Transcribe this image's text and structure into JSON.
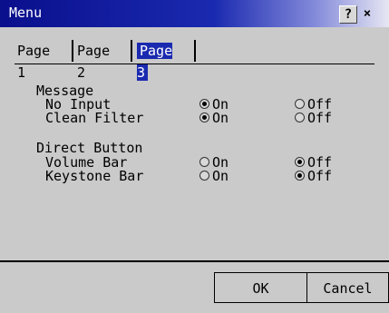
{
  "window": {
    "title": "Menu",
    "help_glyph": "?",
    "close_glyph": "×"
  },
  "tabs": [
    {
      "label": "Page 1",
      "active": false
    },
    {
      "label": "Page 2",
      "active": false
    },
    {
      "label": "Page 3",
      "active": true
    }
  ],
  "groups": [
    {
      "label": "Message",
      "items": [
        {
          "label": "No Input",
          "on_label": "On",
          "off_label": "Off",
          "value": "On"
        },
        {
          "label": "Clean Filter",
          "on_label": "On",
          "off_label": "Off",
          "value": "On"
        }
      ]
    },
    {
      "label": "Direct Button",
      "items": [
        {
          "label": "Volume Bar",
          "on_label": "On",
          "off_label": "Off",
          "value": "Off"
        },
        {
          "label": "Keystone Bar",
          "on_label": "On",
          "off_label": "Off",
          "value": "Off"
        }
      ]
    }
  ],
  "footer": {
    "ok_label": "OK",
    "cancel_label": "Cancel"
  },
  "colors": {
    "titlebar": "#0a0f8c",
    "active_tab": "#1a2ab0",
    "background": "#cacaca"
  }
}
